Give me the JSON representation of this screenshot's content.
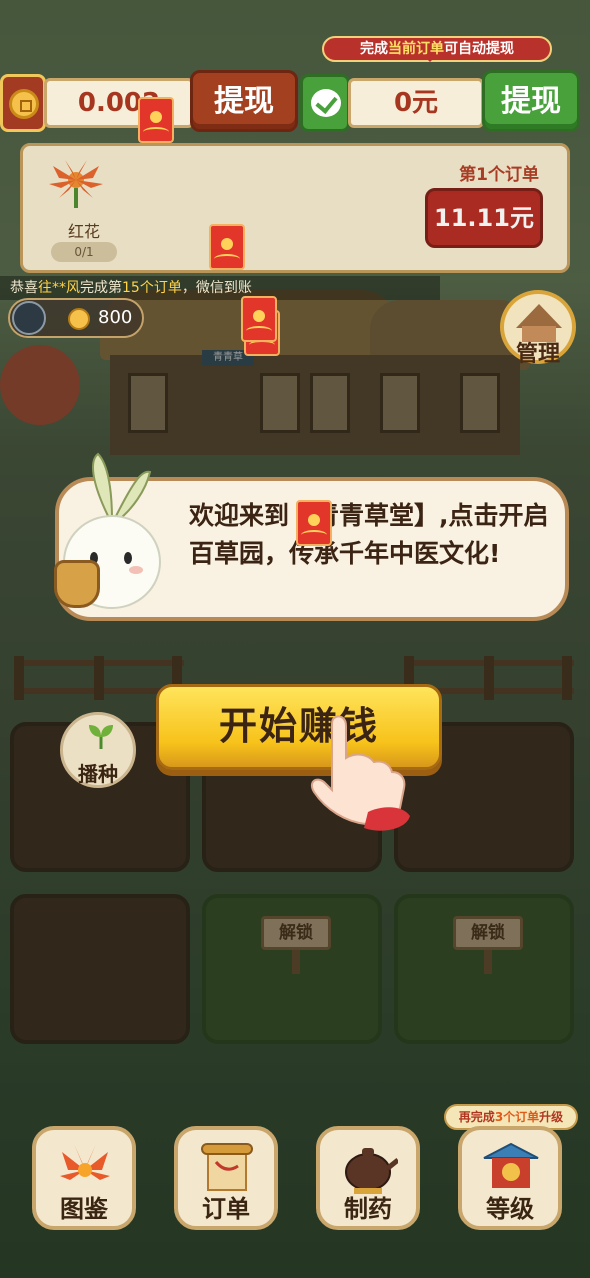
{
  "top_banner": {
    "pre": "完成",
    "highlight": "当前订单",
    "post": "可自动提现"
  },
  "balance": {
    "coin_value": "0.002",
    "coin_withdraw_label": "提现",
    "cash_value": "0元",
    "cash_withdraw_label": "提现"
  },
  "order": {
    "item_name": "红花",
    "item_progress": "0/1",
    "order_label": "第1个订单",
    "order_amount": "11.11元"
  },
  "ticker": {
    "pre": "恭喜",
    "name": "往**风",
    "mid1": "完成第",
    "count": "15个订单",
    "mid2": "，微信到账"
  },
  "player": {
    "coins": "800"
  },
  "manage": {
    "label": "管理"
  },
  "shop_sign": "青青草",
  "dialog": {
    "text": "欢迎来到【青青草堂】,点击开启百草园，传承千年中医文化!"
  },
  "field": {
    "sow_label": "播种",
    "unlock_label_1": "解锁",
    "unlock_label_2": "解锁"
  },
  "start_button": {
    "label": "开始赚钱"
  },
  "bottom_nav": {
    "upgrade_tip": {
      "pre": "再完成",
      "highlight": "3个订单",
      "post": "升级"
    },
    "items": [
      {
        "label": "图鉴",
        "icon": "flower-icon"
      },
      {
        "label": "订单",
        "icon": "scroll-icon"
      },
      {
        "label": "制药",
        "icon": "teapot-icon"
      },
      {
        "label": "等级",
        "icon": "pavilion-icon"
      }
    ]
  },
  "colors": {
    "accent_red": "#b3271f",
    "accent_green": "#48a13b",
    "button_yellow": "#f7c21a"
  }
}
